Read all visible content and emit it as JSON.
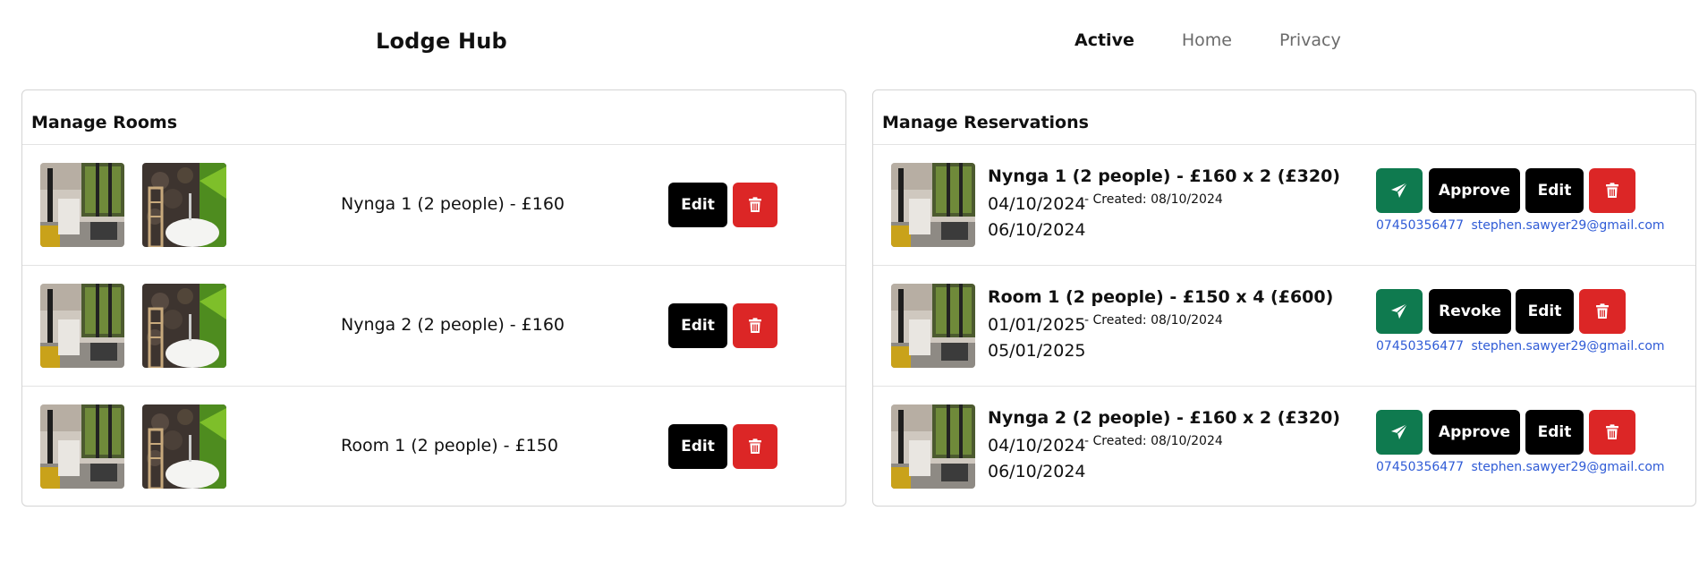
{
  "header": {
    "brand": "Lodge Hub",
    "nav": [
      {
        "label": "Active",
        "active": true
      },
      {
        "label": "Home",
        "active": false
      },
      {
        "label": "Privacy",
        "active": false
      }
    ]
  },
  "rooms": {
    "title": "Manage Rooms",
    "edit_label": "Edit",
    "items": [
      {
        "label": "Nynga 1 (2 people) - £160"
      },
      {
        "label": "Nynga 2 (2 people) - £160"
      },
      {
        "label": "Room 1 (2 people) - £150"
      }
    ]
  },
  "reservations": {
    "title": "Manage Reservations",
    "edit_label": "Edit",
    "items": [
      {
        "title": "Nynga 1 (2 people) - £160 x 2 (£320)",
        "check_in": "04/10/2024",
        "created": "- Created: 08/10/2024",
        "check_out": "06/10/2024",
        "action_label": "Approve",
        "phone": "07450356477",
        "email": "stephen.sawyer29@gmail.com"
      },
      {
        "title": "Room 1 (2 people) - £150 x 4 (£600)",
        "check_in": "01/01/2025",
        "created": "- Created: 08/10/2024",
        "check_out": "05/01/2025",
        "action_label": "Revoke",
        "phone": "07450356477",
        "email": "stephen.sawyer29@gmail.com"
      },
      {
        "title": "Nynga 2 (2 people) - £160 x 2 (£320)",
        "check_in": "04/10/2024",
        "created": "- Created: 08/10/2024",
        "check_out": "06/10/2024",
        "action_label": "Approve",
        "phone": "07450356477",
        "email": "stephen.sawyer29@gmail.com"
      }
    ]
  },
  "icons": {
    "delete": "trash-icon",
    "send": "paper-plane-icon"
  },
  "colors": {
    "primary_button": "#000000",
    "danger_button": "#dc2626",
    "send_button": "#0f7a4f",
    "link": "#2f5bd6"
  }
}
